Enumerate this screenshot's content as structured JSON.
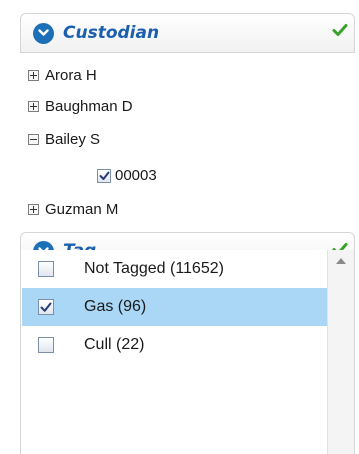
{
  "custodian": {
    "title": "Custodian",
    "header_icon": "chevron-down-circle-icon",
    "status_icon": "green-check-icon",
    "items": [
      {
        "label": "Arora H",
        "state": "collapsed"
      },
      {
        "label": "Baughman D",
        "state": "collapsed"
      },
      {
        "label": "Bailey S",
        "state": "expanded",
        "children": [
          {
            "label": "00003",
            "checked": true
          }
        ]
      },
      {
        "label": "Guzman M",
        "state": "collapsed"
      }
    ]
  },
  "tag": {
    "title": "Tag",
    "header_icon": "chevron-down-circle-icon",
    "status_icon": "green-check-icon",
    "items": [
      {
        "label": "Not Tagged (11652)",
        "checked": false,
        "selected": false
      },
      {
        "label": "Gas (96)",
        "checked": true,
        "selected": true
      },
      {
        "label": "Cull (22)",
        "checked": false,
        "selected": false
      }
    ]
  },
  "colors": {
    "accent_blue": "#1d6fb8",
    "title_blue": "#1b5fae",
    "selection_blue": "#a9d7f5",
    "check_green": "#3aa12a"
  }
}
